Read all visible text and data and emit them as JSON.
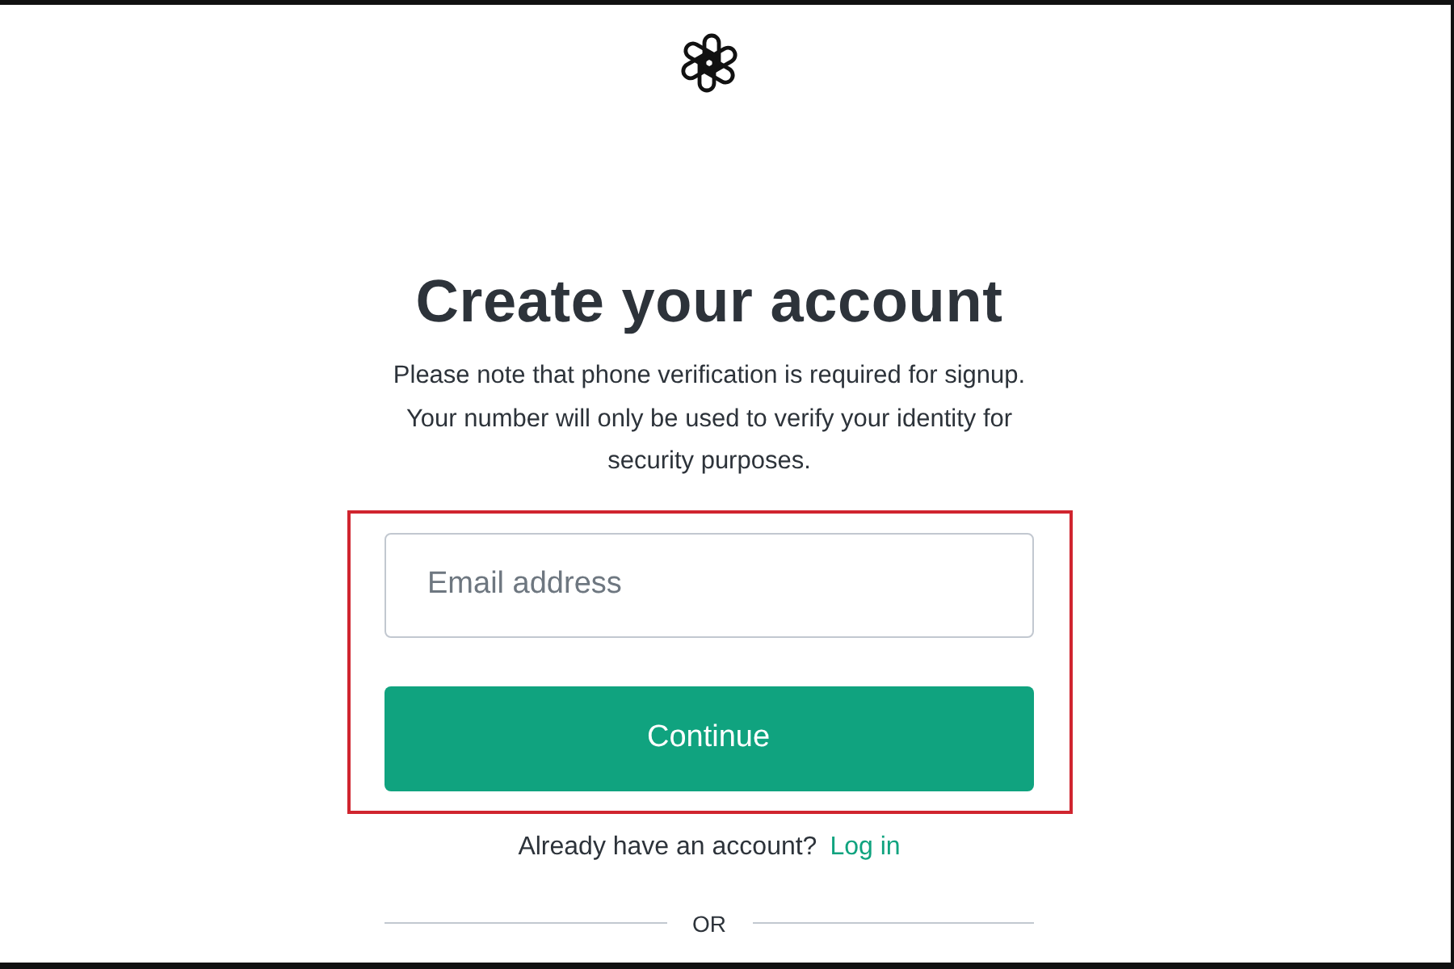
{
  "title": "Create your account",
  "note": "Please note that phone verification is required for signup. Your number will only be used to verify your identity for security purposes.",
  "form": {
    "highlighted": true,
    "email": {
      "placeholder": "Email address"
    },
    "button": "Continue"
  },
  "login_prompt": {
    "text": "Already have an account?",
    "link": "Log in"
  },
  "divider": "OR"
}
